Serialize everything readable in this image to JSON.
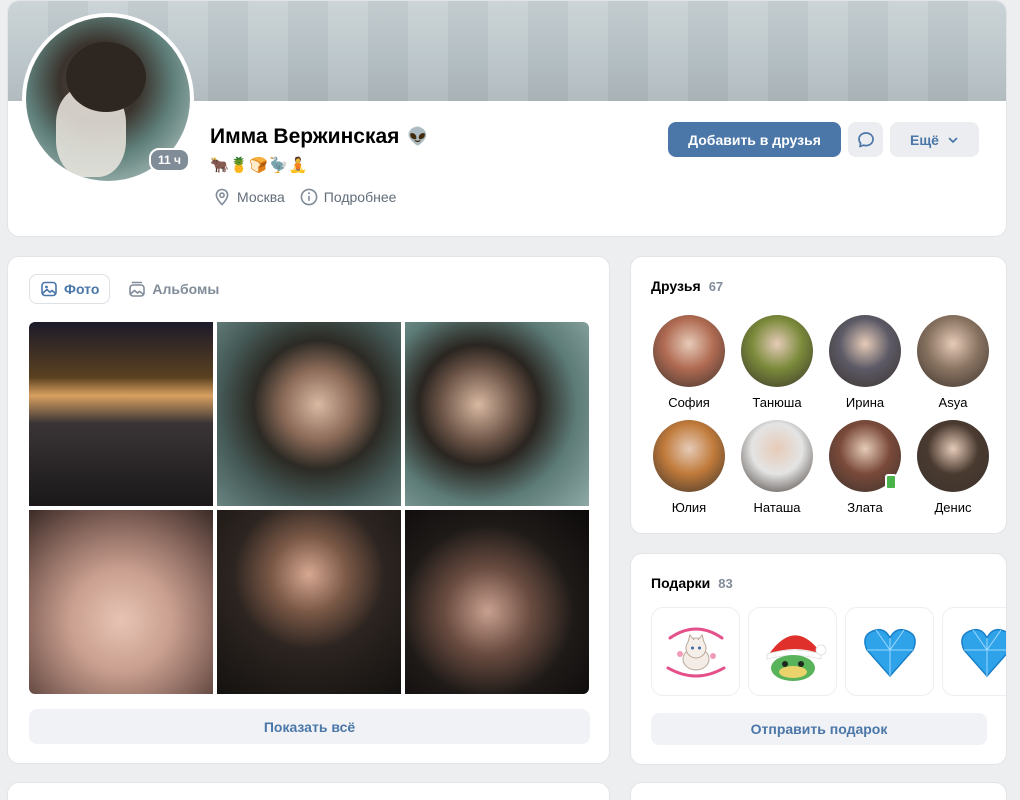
{
  "profile": {
    "name": "Имма Вержинская",
    "name_icon": "alien-icon",
    "online": "11 ч",
    "status": "🐂🍍🍞🦤🧘",
    "city": "Москва",
    "details_label": "Подробнее",
    "add_friend_label": "Добавить в друзья",
    "more_label": "Ещё"
  },
  "photos": {
    "tabs": [
      {
        "label": "Фото",
        "icon": "image-icon",
        "active": true
      },
      {
        "label": "Альбомы",
        "icon": "albums-icon",
        "active": false
      }
    ],
    "show_all_label": "Показать всё"
  },
  "friends": {
    "title": "Друзья",
    "count": "67",
    "items": [
      {
        "name": "София",
        "color": "#b06a52"
      },
      {
        "name": "Танюша",
        "color": "#7a8a3a"
      },
      {
        "name": "Ирина",
        "color": "#5c5a66"
      },
      {
        "name": "Asya",
        "color": "#8a7462"
      },
      {
        "name": "Юлия",
        "color": "#c07a3a"
      },
      {
        "name": "Наташа",
        "color": "#e4e4e4"
      },
      {
        "name": "Злата",
        "color": "#7a4a3a"
      },
      {
        "name": "Денис",
        "color": "#4a3a30"
      }
    ]
  },
  "gifts": {
    "title": "Подарки",
    "count": "83",
    "send_label": "Отправить подарок",
    "items": [
      "cat-sticker",
      "snake-santa-sticker",
      "blue-heart-sticker",
      "blue-heart-sticker"
    ]
  },
  "colors": {
    "accent": "#4a76a8",
    "background": "#edeef0"
  }
}
